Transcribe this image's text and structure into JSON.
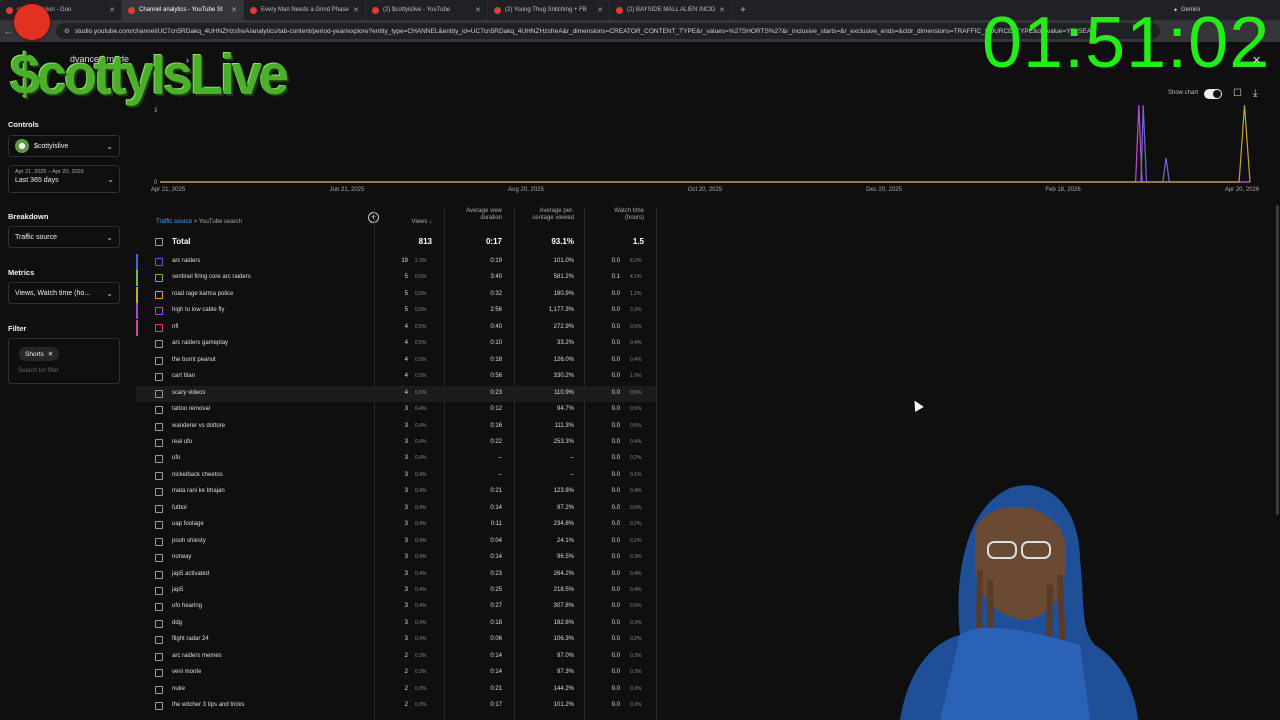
{
  "browser": {
    "tabs": [
      {
        "title": "ot one opinion - Goo",
        "active": false
      },
      {
        "title": "Channel analytics - YouTube St",
        "active": true
      },
      {
        "title": "Every Man Needs a Grind Phase",
        "active": false
      },
      {
        "title": "(2) $cottyislive - YouTube",
        "active": false
      },
      {
        "title": "(2) Young Thug Snitching + FB",
        "active": false
      },
      {
        "title": "(2) BAYSIDE MALL ALIEN INCID",
        "active": false
      }
    ],
    "gemini_label": "Gemini",
    "url": "studio.youtube.com/channel/UC7cn5RDakq_4UHNZHzsfreA/analytics/tab-content/period-year/explore?entity_type=CHANNEL&entity_id=UC7cn5RDakq_4UHNZHzsfreA&r_dimensions=CREATOR_CONTENT_TYPE&r_values=%27SHORTS%27&r_inclusive_starts=&r_exclusive_ends=&cldr_dimensions=TRAFFIC_SOURCE_TYPE&dr_value=YT_SEAR"
  },
  "overlay": {
    "brand": "$cottyIsLive",
    "timer": "01:51:02"
  },
  "page": {
    "mode_label": "dvanced mode"
  },
  "sidebar": {
    "controls_label": "Controls",
    "channel_name": "$cottyislive",
    "date_range_sub": "Apr 21, 2025 – Apr 20, 2026",
    "date_range_main": "Last 365 days",
    "breakdown_label": "Breakdown",
    "breakdown_value": "Traffic source",
    "metrics_label": "Metrics",
    "metrics_value": "Views, Watch time (ho...",
    "filter_label": "Filter",
    "filter_chip": "Shorts",
    "filter_placeholder": "Search for filter"
  },
  "chart_controls": {
    "show_chart": "Show chart"
  },
  "chart_data": {
    "type": "line",
    "x_ticks": [
      "Apr 21, 2025",
      "Jun 21, 2025",
      "Aug 20, 2025",
      "Oct 20, 2025",
      "Dec 20, 2025",
      "Feb 18, 2026",
      "Apr 20, 2026"
    ],
    "y_ticks": [
      "0",
      "3"
    ],
    "ylim": [
      0,
      3
    ],
    "series": [
      {
        "color": "#6b6bd6",
        "points": [
          [
            0,
            0
          ],
          [
            0.9,
            0
          ],
          [
            0.902,
            3.2
          ],
          [
            0.905,
            0
          ],
          [
            0.92,
            0
          ],
          [
            0.923,
            1.0
          ],
          [
            0.926,
            0
          ],
          [
            1,
            0
          ]
        ]
      },
      {
        "color": "#c04bd6",
        "points": [
          [
            0,
            0
          ],
          [
            0.895,
            0
          ],
          [
            0.898,
            3.2
          ],
          [
            0.901,
            0
          ],
          [
            1,
            0
          ]
        ]
      },
      {
        "color": "#c9a52a",
        "points": [
          [
            0,
            0
          ],
          [
            0.99,
            0
          ],
          [
            0.995,
            3.2
          ],
          [
            1,
            0
          ]
        ]
      }
    ]
  },
  "table": {
    "breadcrumb_source": "Traffic source",
    "breadcrumb_current": "YouTube search",
    "headers": {
      "views": "Views ↓",
      "avg_dur": "Average view duration",
      "avg_pct": "Average per-centage viewed",
      "watch": "Watch time (hours)"
    },
    "total": {
      "label": "Total",
      "views": "813",
      "avg_dur": "0:17",
      "avg_pct": "93.1%",
      "watch": "1.5"
    },
    "rows": [
      {
        "label": "arc raiders",
        "views": "19",
        "vp": "2.3%",
        "dur": "0:19",
        "pct": "101.0%",
        "watch": "0.0",
        "wp": "8.2%",
        "color": "#5a5ae0"
      },
      {
        "label": "sentinel firing core arc raiders",
        "views": "5",
        "vp": "0.6%",
        "dur": "3:40",
        "pct": "581.2%",
        "watch": "0.1",
        "wp": "4.1%",
        "color": "#7ab83a"
      },
      {
        "label": "road rage karma police",
        "views": "5",
        "vp": "0.6%",
        "dur": "0:32",
        "pct": "180.9%",
        "watch": "0.0",
        "wp": "1.2%",
        "color": "#d9a227"
      },
      {
        "label": "high to low cable fly",
        "views": "5",
        "vp": "0.6%",
        "dur": "2:56",
        "pct": "1,177.3%",
        "watch": "0.0",
        "wp": "3.3%",
        "color": "#a04bd6"
      },
      {
        "label": "nfl",
        "views": "4",
        "vp": "0.5%",
        "dur": "0:40",
        "pct": "272.9%",
        "watch": "0.0",
        "wp": "0.5%",
        "color": "#d9428a"
      },
      {
        "label": "arc raiders gameplay",
        "views": "4",
        "vp": "0.5%",
        "dur": "0:10",
        "pct": "33.2%",
        "watch": "0.0",
        "wp": "0.4%",
        "color": ""
      },
      {
        "label": "the burnt peanut",
        "views": "4",
        "vp": "0.5%",
        "dur": "0:18",
        "pct": "126.0%",
        "watch": "0.0",
        "wp": "0.4%",
        "color": ""
      },
      {
        "label": "cart titan",
        "views": "4",
        "vp": "0.5%",
        "dur": "0:56",
        "pct": "330.2%",
        "watch": "0.0",
        "wp": "1.0%",
        "color": ""
      },
      {
        "label": "scary videos",
        "views": "4",
        "vp": "0.5%",
        "dur": "0:23",
        "pct": "110.9%",
        "watch": "0.0",
        "wp": "0.5%",
        "color": ""
      },
      {
        "label": "tattoo removal",
        "views": "3",
        "vp": "0.4%",
        "dur": "0:12",
        "pct": "94.7%",
        "watch": "0.0",
        "wp": "0.5%",
        "color": ""
      },
      {
        "label": "wanderer vs dottore",
        "views": "3",
        "vp": "0.4%",
        "dur": "0:16",
        "pct": "111.3%",
        "watch": "0.0",
        "wp": "0.6%",
        "color": ""
      },
      {
        "label": "real ufo",
        "views": "3",
        "vp": "0.4%",
        "dur": "0:22",
        "pct": "253.3%",
        "watch": "0.0",
        "wp": "0.4%",
        "color": ""
      },
      {
        "label": "ufo",
        "views": "3",
        "vp": "0.4%",
        "dur": "–",
        "pct": "–",
        "watch": "0.0",
        "wp": "0.2%",
        "color": ""
      },
      {
        "label": "nickelback cheetos",
        "views": "3",
        "vp": "0.4%",
        "dur": "–",
        "pct": "–",
        "watch": "0.0",
        "wp": "0.1%",
        "color": ""
      },
      {
        "label": "mata rani ke bhajan",
        "views": "3",
        "vp": "0.4%",
        "dur": "0:21",
        "pct": "123.8%",
        "watch": "0.0",
        "wp": "0.4%",
        "color": ""
      },
      {
        "label": "futbol",
        "views": "3",
        "vp": "0.4%",
        "dur": "0:14",
        "pct": "97.2%",
        "watch": "0.0",
        "wp": "0.5%",
        "color": ""
      },
      {
        "label": "uap footage",
        "views": "3",
        "vp": "0.4%",
        "dur": "0:11",
        "pct": "234.8%",
        "watch": "0.0",
        "wp": "0.2%",
        "color": ""
      },
      {
        "label": "pooh shiesty",
        "views": "3",
        "vp": "0.4%",
        "dur": "0:04",
        "pct": "24.1%",
        "watch": "0.0",
        "wp": "0.2%",
        "color": ""
      },
      {
        "label": "norway",
        "views": "3",
        "vp": "0.4%",
        "dur": "0:14",
        "pct": "96.5%",
        "watch": "0.0",
        "wp": "0.3%",
        "color": ""
      },
      {
        "label": "jap5 activated",
        "views": "3",
        "vp": "0.4%",
        "dur": "0:23",
        "pct": "264.2%",
        "watch": "0.0",
        "wp": "0.4%",
        "color": ""
      },
      {
        "label": "jap5",
        "views": "3",
        "vp": "0.4%",
        "dur": "0:25",
        "pct": "218.5%",
        "watch": "0.0",
        "wp": "0.4%",
        "color": ""
      },
      {
        "label": "ufo hearing",
        "views": "3",
        "vp": "0.4%",
        "dur": "0:27",
        "pct": "307.8%",
        "watch": "0.0",
        "wp": "0.5%",
        "color": ""
      },
      {
        "label": "ddg",
        "views": "3",
        "vp": "0.4%",
        "dur": "0:18",
        "pct": "182.6%",
        "watch": "0.0",
        "wp": "0.3%",
        "color": ""
      },
      {
        "label": "flight radar 24",
        "views": "3",
        "vp": "0.4%",
        "dur": "0:06",
        "pct": "106.3%",
        "watch": "0.0",
        "wp": "0.2%",
        "color": ""
      },
      {
        "label": "arc raiders memes",
        "views": "2",
        "vp": "0.3%",
        "dur": "0:14",
        "pct": "97.0%",
        "watch": "0.0",
        "wp": "0.2%",
        "color": ""
      },
      {
        "label": "veni monte",
        "views": "2",
        "vp": "0.3%",
        "dur": "0:14",
        "pct": "97.3%",
        "watch": "0.0",
        "wp": "0.3%",
        "color": ""
      },
      {
        "label": "nuke",
        "views": "2",
        "vp": "0.3%",
        "dur": "0:21",
        "pct": "144.2%",
        "watch": "0.0",
        "wp": "0.3%",
        "color": ""
      },
      {
        "label": "the witcher 3 tips and tricks",
        "views": "2",
        "vp": "0.3%",
        "dur": "0:17",
        "pct": "101.2%",
        "watch": "0.0",
        "wp": "0.3%",
        "color": ""
      }
    ],
    "highlighted_row": 8
  }
}
